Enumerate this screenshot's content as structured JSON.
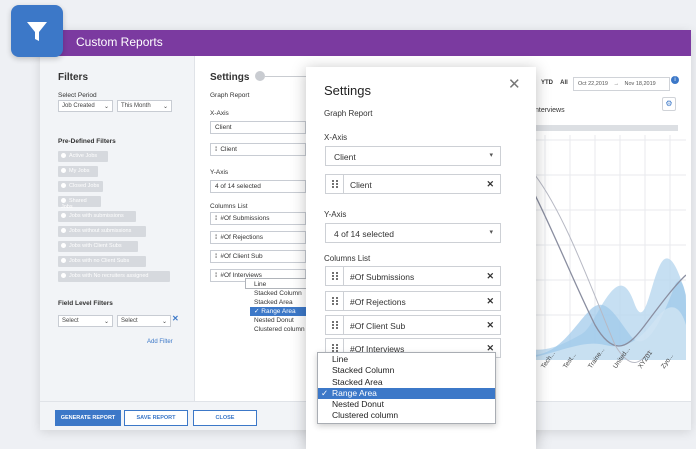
{
  "app": {
    "title": "Custom Reports"
  },
  "filters": {
    "heading": "Filters",
    "select_period_label": "Select Period",
    "period_type": "Job Created",
    "period_value": "This Month",
    "predefined_heading": "Pre-Defined Filters",
    "chips": [
      "Active Jobs",
      "My Jobs",
      "Closed Jobs",
      "Shared Jobs",
      "Jobs with submissions",
      "Jobs without submissions",
      "Jobs with Client Subs",
      "Jobs with no Client Subs",
      "Jobs with No recruiters assigned"
    ],
    "field_level_heading": "Field Level Filters",
    "field_select_1": "Select",
    "field_select_2": "Select",
    "add_filter": "Add Filter"
  },
  "settings_back": {
    "heading": "Settings",
    "graph_report": "Graph Report",
    "xaxis_label": "X-Axis",
    "xaxis_value": "Client",
    "xaxis_item": "Client",
    "yaxis_label": "Y-Axis",
    "yaxis_value": "4 of 14 selected",
    "columns_label": "Columns List",
    "columns": [
      "#Of Submissions",
      "#Of Rejections",
      "#Of Client Sub",
      "#Of Interviews"
    ]
  },
  "chart_types": [
    "Line",
    "Stacked Column",
    "Stacked Area",
    "Range Area",
    "Nested Donut",
    "Clustered column"
  ],
  "chart_selected": "Range Area",
  "footer": {
    "generate": "GENERATE REPORT",
    "save": "SAVE REPORT",
    "close": "CLOSE"
  },
  "right_panel": {
    "ytd": "YTD",
    "all": "All",
    "date_from": "Oct 22,2019",
    "arrow": "→",
    "date_to": "Nov 18,2019",
    "chart_title": "nterviews",
    "x_labels": [
      "Tech...",
      "Test...",
      "Traine...",
      "United...",
      "XYZ01",
      "Zyo..."
    ]
  },
  "modal": {
    "title": "Settings",
    "graph_report": "Graph Report",
    "xaxis_label": "X-Axis",
    "xaxis_value": "Client",
    "xaxis_item": "Client",
    "yaxis_label": "Y-Axis",
    "yaxis_value": "4 of 14 selected",
    "columns_label": "Columns List",
    "columns": [
      "#Of Submissions",
      "#Of Rejections",
      "#Of Client Sub",
      "#Of Interviews"
    ]
  },
  "colors": {
    "purple": "#7b3aa0",
    "primary": "#3c78c8",
    "area_fill": "#b8d7ef"
  }
}
